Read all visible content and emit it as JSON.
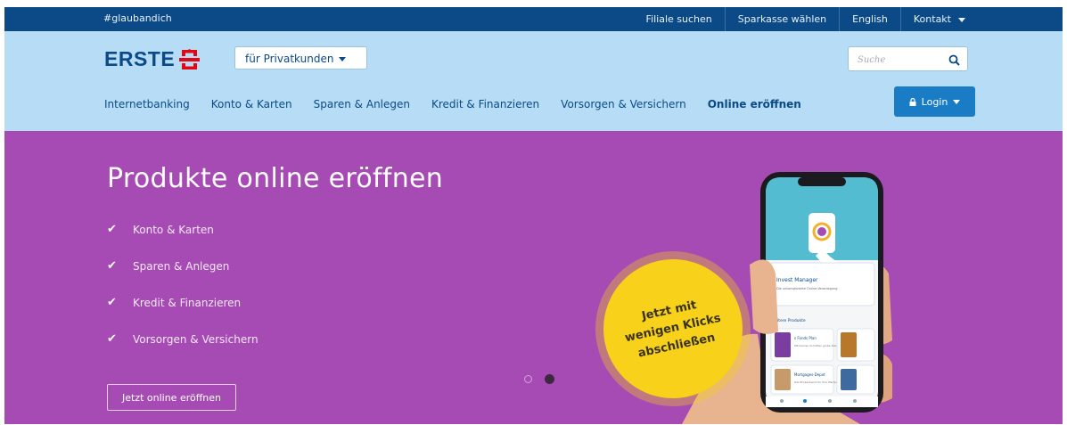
{
  "topbar": {
    "hashtag": "#glaubandich",
    "links": [
      "Filiale suchen",
      "Sparkasse wählen",
      "English",
      "Kontakt"
    ]
  },
  "header": {
    "logo_text": "ERSTE",
    "segment_select": "für Privatkunden",
    "search_placeholder": "Suche",
    "nav": [
      "Internetbanking",
      "Konto & Karten",
      "Sparen & Anlegen",
      "Kredit & Finanzieren",
      "Vorsorgen & Versichern",
      "Online eröffnen"
    ],
    "active_nav": "Online eröffnen",
    "login_label": "Login"
  },
  "hero": {
    "title": "Produkte online eröffnen",
    "checklist": [
      "Konto & Karten",
      "Sparen & Anlegen",
      "Kredit & Finanzieren",
      "Vorsorgen & Versichern"
    ],
    "cta_label": "Jetzt online eröffnen",
    "badge_lines": [
      "Jetzt mit",
      "wenigen Klicks",
      "abschließen"
    ],
    "carousel_active_index": 2,
    "phone_app": {
      "card_title": "Invest Manager",
      "card_sub": "Die unkomplizierte Online-Veranlagung",
      "section_label": "Weitere Produkte",
      "item1_title": "s Fonds Plan",
      "item1_sub": "Mit kleinen Schritten große Ziele erreichen",
      "item2_title": "Mortgages-Depot",
      "item2_sub": "Das Brokerdepot für Ihre Wertpapiere"
    }
  },
  "colors": {
    "topbar": "#0b4a86",
    "header": "#b6ddf5",
    "hero": "#a64ab4",
    "login": "#1a7cc4",
    "badge": "#f7d11a",
    "brand_red": "#e30613"
  }
}
